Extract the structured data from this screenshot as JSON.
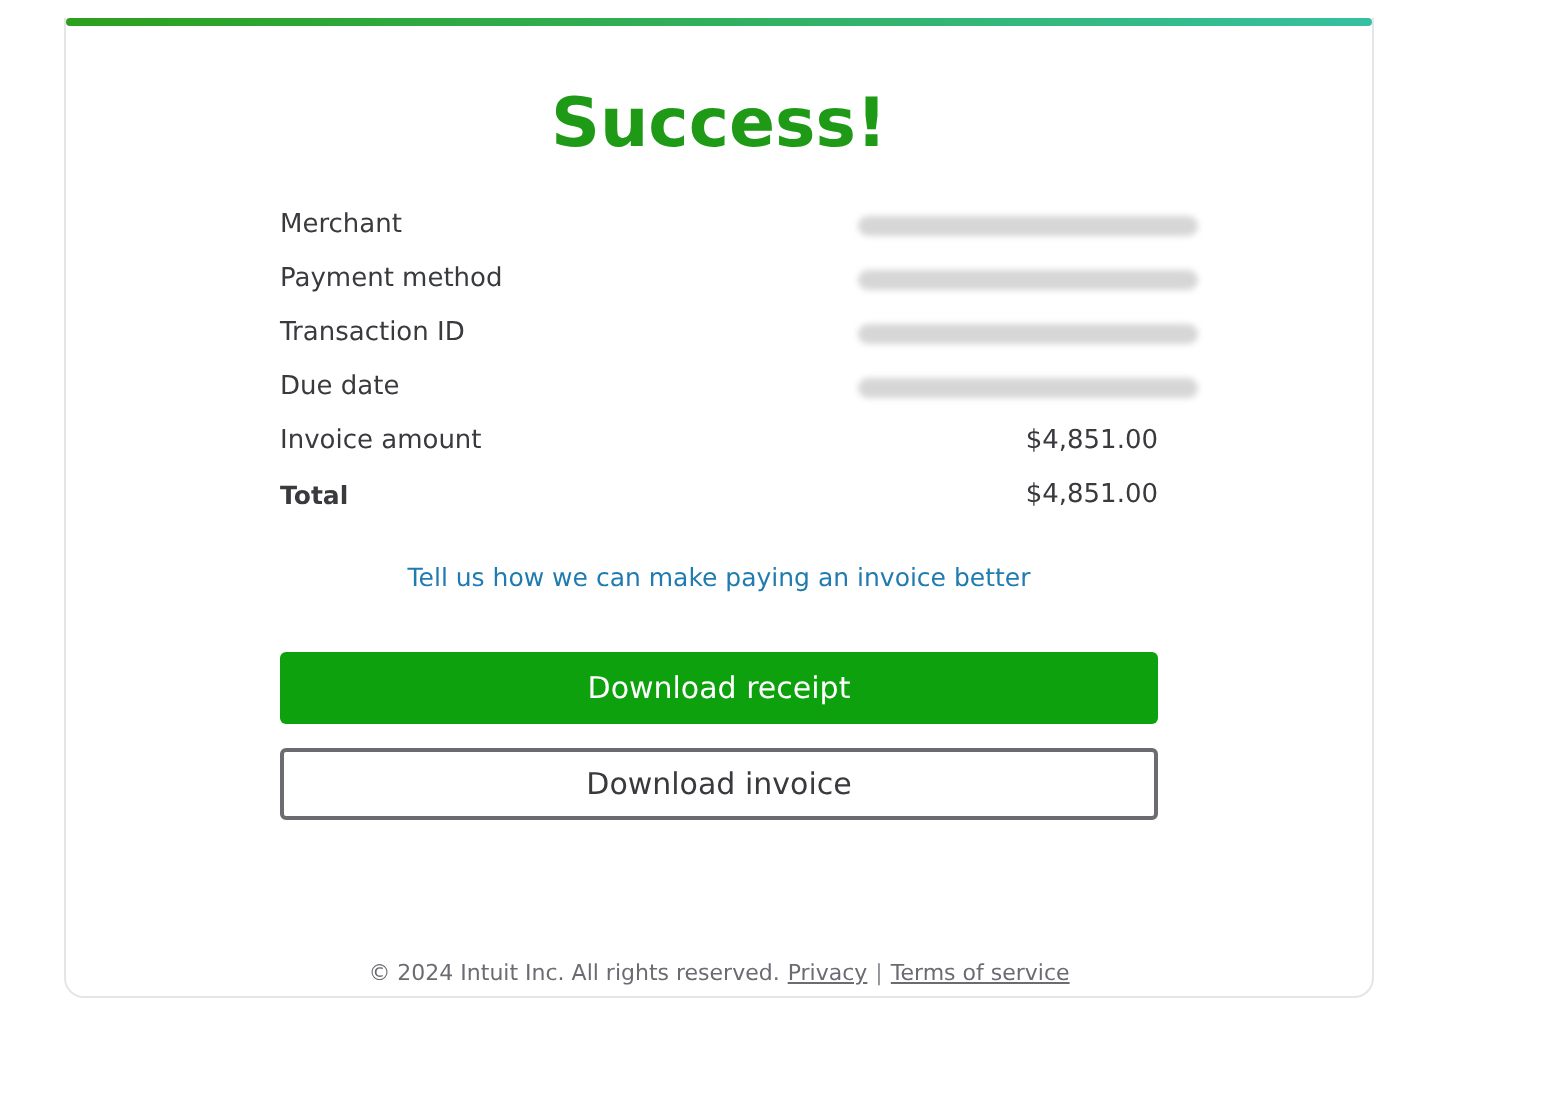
{
  "title": "Success!",
  "details": [
    {
      "label": "Merchant",
      "redacted": true,
      "bold": false
    },
    {
      "label": "Payment method",
      "redacted": true,
      "bold": false
    },
    {
      "label": "Transaction ID",
      "redacted": true,
      "bold": false
    },
    {
      "label": "Due date",
      "redacted": true,
      "bold": false
    },
    {
      "label": "Invoice amount",
      "value": "$4,851.00",
      "redacted": false,
      "bold": false
    },
    {
      "label": "Total",
      "value": "$4,851.00",
      "redacted": false,
      "bold": true
    }
  ],
  "feedback_link": "Tell us how we can make paying an invoice better",
  "buttons": [
    {
      "label": "Download receipt",
      "kind": "primary"
    },
    {
      "label": "Download invoice",
      "kind": "secondary"
    }
  ],
  "footer": {
    "copyright": "© 2024 Intuit Inc. All rights reserved.",
    "links": [
      "Privacy",
      "Terms of service"
    ],
    "separator": "|"
  }
}
